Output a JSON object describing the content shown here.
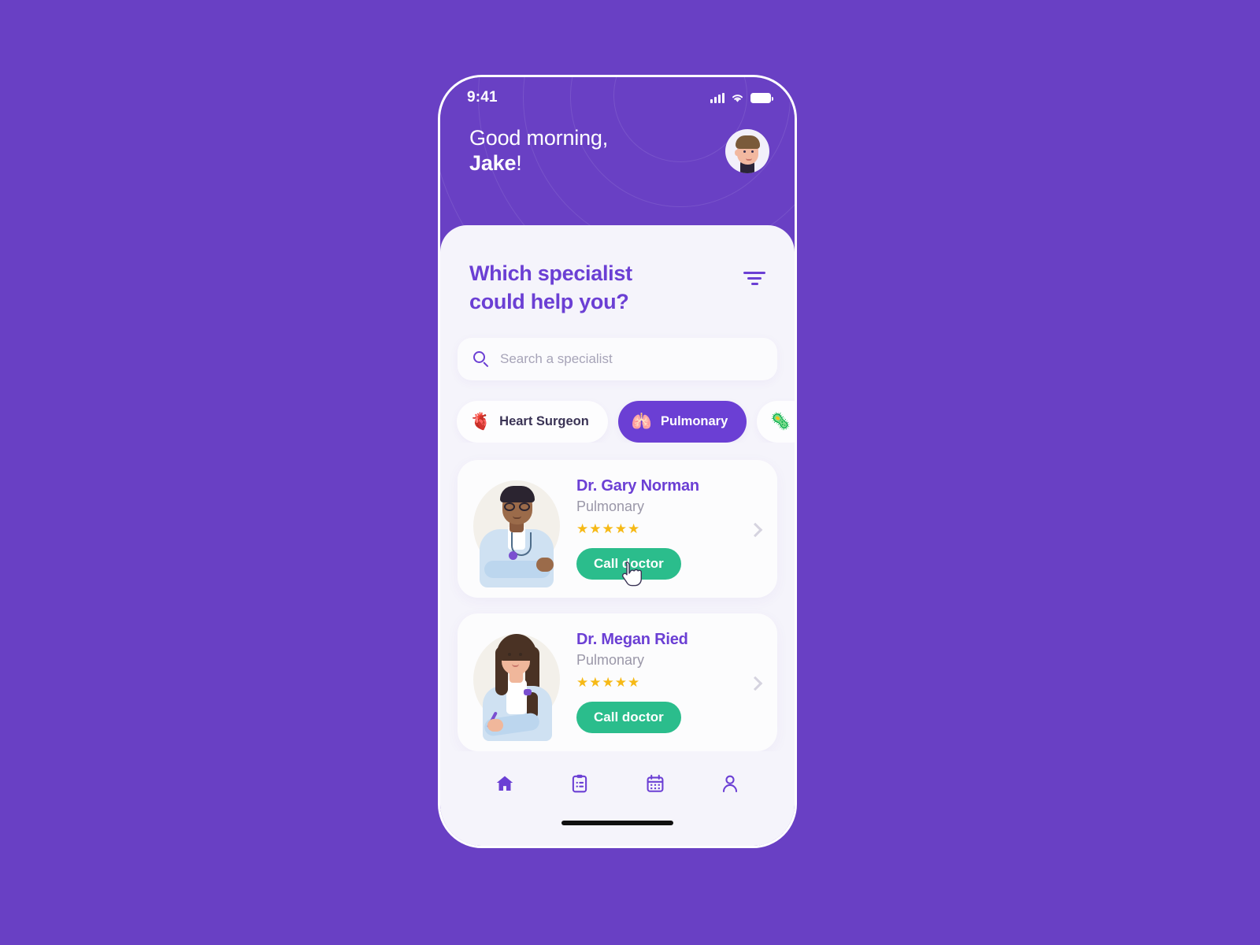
{
  "status_bar": {
    "time": "9:41",
    "signal_icon": "signal-bars-icon",
    "wifi_icon": "wifi-icon",
    "battery_icon": "battery-icon"
  },
  "header": {
    "greeting_line1": "Good morning,",
    "greeting_name": "Jake",
    "greeting_punctuation": "!",
    "avatar_name": "user-avatar",
    "background_color": "#6940C4"
  },
  "main": {
    "title": "Which specialist\ncould help you?",
    "title_color": "#6B3FD4",
    "filter_label": "filter"
  },
  "search": {
    "placeholder": "Search a specialist",
    "value": "",
    "icon": "search-icon"
  },
  "categories": [
    {
      "label": "Heart Surgeon",
      "emoji": "🫀",
      "icon_name": "heart-organ-icon",
      "active": false
    },
    {
      "label": "Pulmonary",
      "emoji": "🫁",
      "icon_name": "lungs-icon",
      "active": true
    },
    {
      "label": "",
      "emoji": "🦠",
      "icon_name": "microbe-icon",
      "active": false
    }
  ],
  "doctors": [
    {
      "name": "Dr. Gary Norman",
      "specialty": "Pulmonary",
      "stars": "★★★★★",
      "rating": 5,
      "call_label": "Call doctor",
      "photo_name": "doctor-gary-photo"
    },
    {
      "name": "Dr. Megan Ried",
      "specialty": "Pulmonary",
      "stars": "★★★★★",
      "rating": 5,
      "call_label": "Call doctor",
      "photo_name": "doctor-megan-photo"
    }
  ],
  "bottom_nav": [
    {
      "icon": "home-icon",
      "active": true
    },
    {
      "icon": "clipboard-icon",
      "active": false
    },
    {
      "icon": "calendar-icon",
      "active": false
    },
    {
      "icon": "profile-icon",
      "active": false
    }
  ],
  "colors": {
    "brand_purple": "#6940C4",
    "accent_purple": "#6B3FD4",
    "call_green": "#2BBD8C",
    "star_gold": "#F6B916",
    "sheet_bg": "#F5F4FB"
  },
  "cursor": {
    "type": "pointer-hand"
  }
}
